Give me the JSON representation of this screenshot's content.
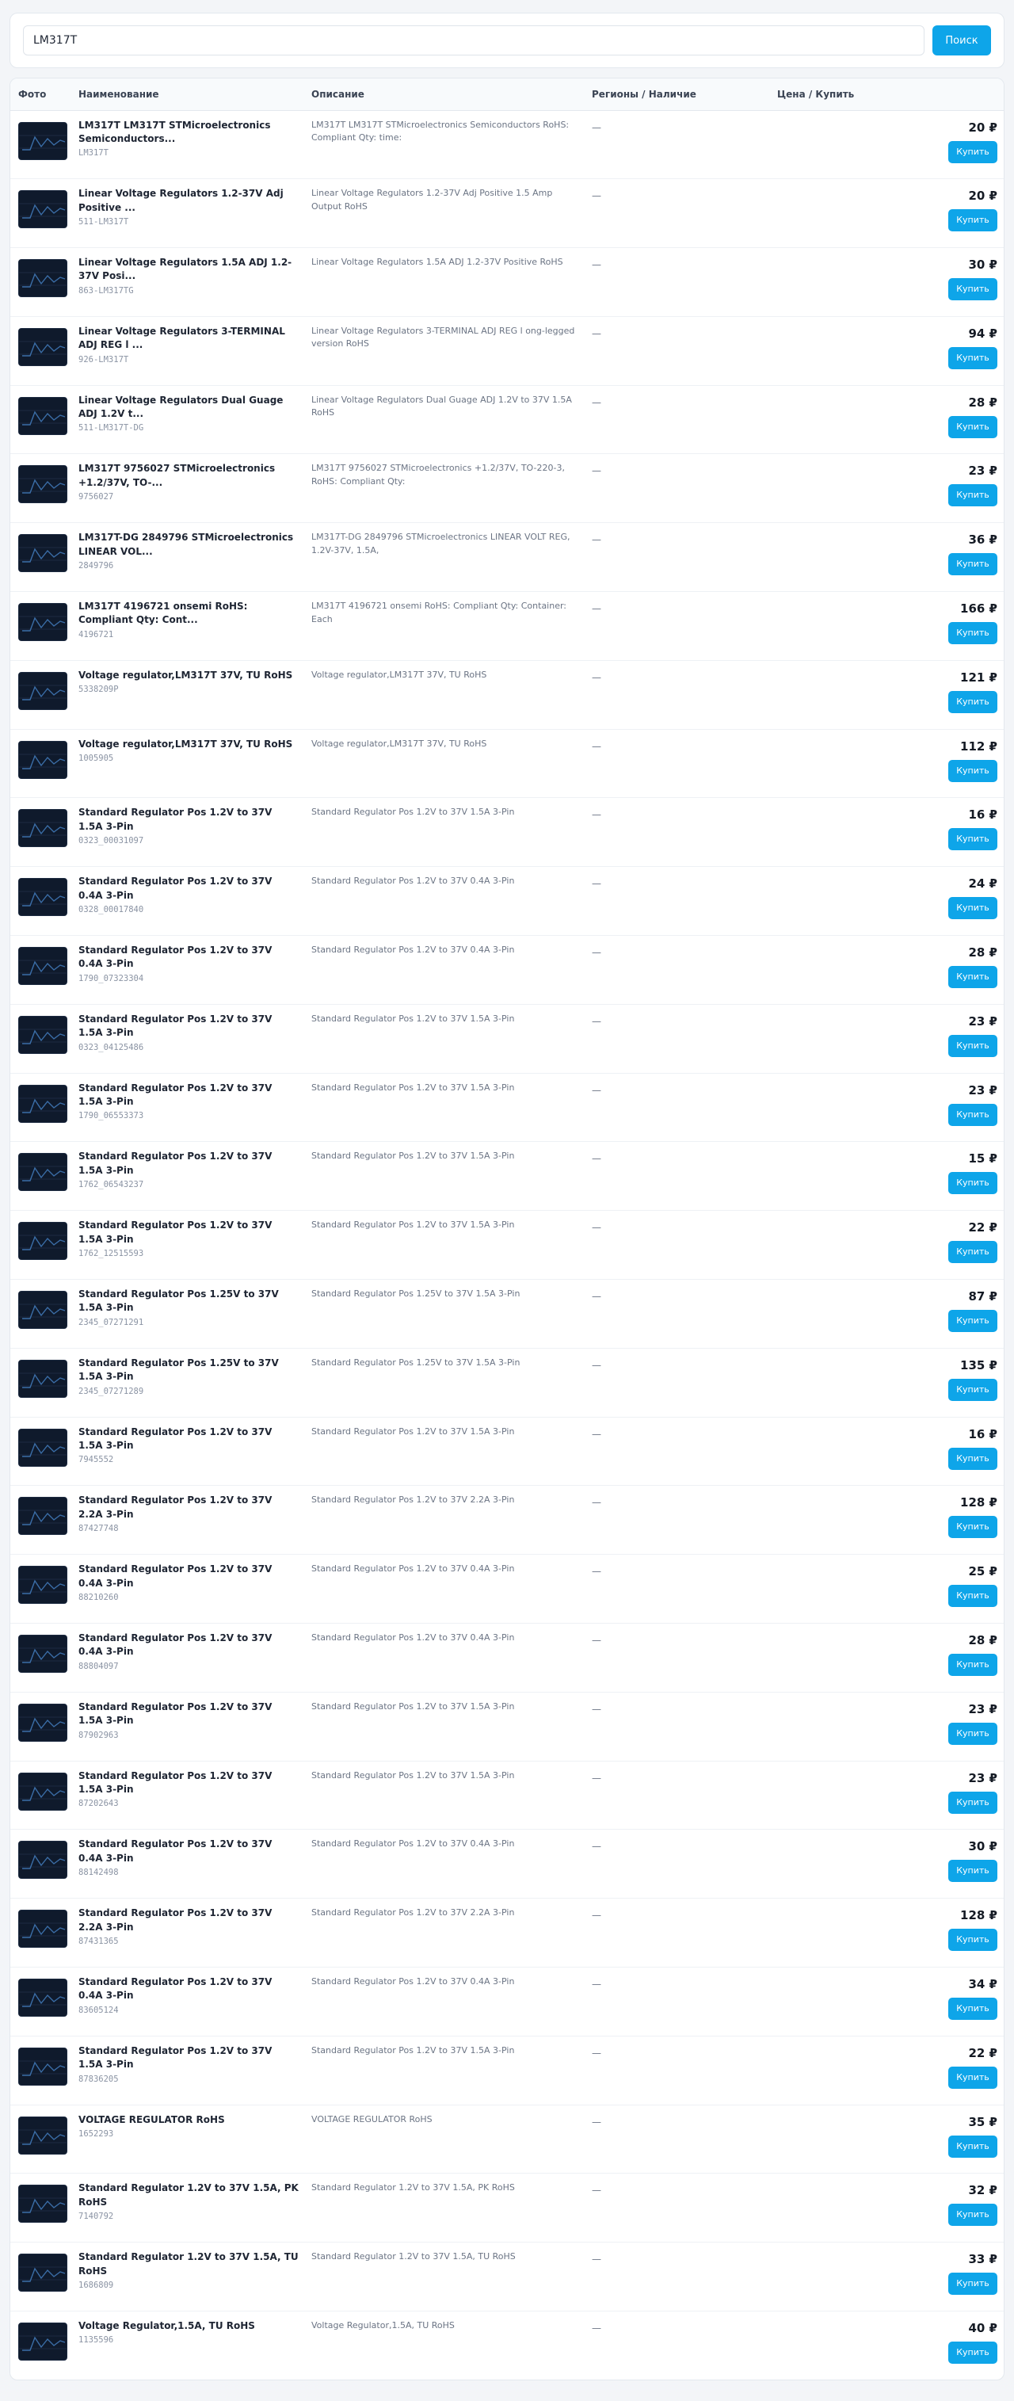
{
  "search": {
    "value": "LM317T",
    "button_label": "Поиск"
  },
  "table": {
    "headers": {
      "photo": "Фото",
      "name": "Наименование",
      "description": "Описание",
      "regions": "Регионы / Наличие",
      "price": "Цена / Купить"
    },
    "buy_label": "Купить",
    "rows": [
      {
        "name": "LM317T LM317T STMicroelectronics Semiconductors...",
        "code": "LM317T",
        "description": "LM317T LM317T STMicroelectronics Semiconductors RoHS: Compliant Qty: time:",
        "regions": "—",
        "price": "20 ₽"
      },
      {
        "name": "Linear Voltage Regulators 1.2-37V Adj Positive ...",
        "code": "511-LM317T",
        "description": "Linear Voltage Regulators 1.2-37V Adj Positive 1.5 Amp Output RoHS",
        "regions": "—",
        "price": "20 ₽"
      },
      {
        "name": "Linear Voltage Regulators 1.5A ADJ 1.2-37V Posi...",
        "code": "863-LM317TG",
        "description": "Linear Voltage Regulators 1.5A ADJ 1.2-37V Positive RoHS",
        "regions": "—",
        "price": "30 ₽"
      },
      {
        "name": "Linear Voltage Regulators 3-TERMINAL ADJ REG l ...",
        "code": "926-LM317T",
        "description": "Linear Voltage Regulators 3-TERMINAL ADJ REG l ong-legged version RoHS",
        "regions": "—",
        "price": "94 ₽"
      },
      {
        "name": "Linear Voltage Regulators Dual Guage ADJ 1.2V t...",
        "code": "511-LM317T-DG",
        "description": "Linear Voltage Regulators Dual Guage ADJ 1.2V to 37V 1.5A RoHS",
        "regions": "—",
        "price": "28 ₽"
      },
      {
        "name": "LM317T 9756027 STMicroelectronics +1.2/37V, TO-...",
        "code": "9756027",
        "description": "LM317T 9756027 STMicroelectronics +1.2/37V, TO-220-3, RoHS: Compliant Qty:",
        "regions": "—",
        "price": "23 ₽"
      },
      {
        "name": "LM317T-DG 2849796 STMicroelectronics LINEAR VOL...",
        "code": "2849796",
        "description": "LM317T-DG 2849796 STMicroelectronics LINEAR VOLT REG, 1.2V-37V, 1.5A,",
        "regions": "—",
        "price": "36 ₽"
      },
      {
        "name": "LM317T 4196721 onsemi RoHS: Compliant Qty: Cont...",
        "code": "4196721",
        "description": "LM317T 4196721 onsemi RoHS: Compliant Qty: Container: Each",
        "regions": "—",
        "price": "166 ₽"
      },
      {
        "name": "Voltage regulator,LM317T 37V, TU RoHS",
        "code": "5338209P",
        "description": "Voltage regulator,LM317T 37V, TU RoHS",
        "regions": "—",
        "price": "121 ₽"
      },
      {
        "name": "Voltage regulator,LM317T 37V, TU RoHS",
        "code": "1005905",
        "description": "Voltage regulator,LM317T 37V, TU RoHS",
        "regions": "—",
        "price": "112 ₽"
      },
      {
        "name": "Standard Regulator Pos 1.2V to 37V 1.5A 3-Pin",
        "code": "0323_00031097",
        "description": "Standard Regulator Pos 1.2V to 37V 1.5A 3-Pin",
        "regions": "—",
        "price": "16 ₽"
      },
      {
        "name": "Standard Regulator Pos 1.2V to 37V 0.4A 3-Pin",
        "code": "0328_00017840",
        "description": "Standard Regulator Pos 1.2V to 37V 0.4A 3-Pin",
        "regions": "—",
        "price": "24 ₽"
      },
      {
        "name": "Standard Regulator Pos 1.2V to 37V 0.4A 3-Pin",
        "code": "1790_07323304",
        "description": "Standard Regulator Pos 1.2V to 37V 0.4A 3-Pin",
        "regions": "—",
        "price": "28 ₽"
      },
      {
        "name": "Standard Regulator Pos 1.2V to 37V 1.5A 3-Pin",
        "code": "0323_04125486",
        "description": "Standard Regulator Pos 1.2V to 37V 1.5A 3-Pin",
        "regions": "—",
        "price": "23 ₽"
      },
      {
        "name": "Standard Regulator Pos 1.2V to 37V 1.5A 3-Pin",
        "code": "1790_06553373",
        "description": "Standard Regulator Pos 1.2V to 37V 1.5A 3-Pin",
        "regions": "—",
        "price": "23 ₽"
      },
      {
        "name": "Standard Regulator Pos 1.2V to 37V 1.5A 3-Pin",
        "code": "1762_06543237",
        "description": "Standard Regulator Pos 1.2V to 37V 1.5A 3-Pin",
        "regions": "—",
        "price": "15 ₽"
      },
      {
        "name": "Standard Regulator Pos 1.2V to 37V 1.5A 3-Pin",
        "code": "1762_12515593",
        "description": "Standard Regulator Pos 1.2V to 37V 1.5A 3-Pin",
        "regions": "—",
        "price": "22 ₽"
      },
      {
        "name": "Standard Regulator Pos 1.25V to 37V 1.5A 3-Pin",
        "code": "2345_07271291",
        "description": "Standard Regulator Pos 1.25V to 37V 1.5A 3-Pin",
        "regions": "—",
        "price": "87 ₽"
      },
      {
        "name": "Standard Regulator Pos 1.25V to 37V 1.5A 3-Pin",
        "code": "2345_07271289",
        "description": "Standard Regulator Pos 1.25V to 37V 1.5A 3-Pin",
        "regions": "—",
        "price": "135 ₽"
      },
      {
        "name": "Standard Regulator Pos 1.2V to 37V 1.5A 3-Pin",
        "code": "7945552",
        "description": "Standard Regulator Pos 1.2V to 37V 1.5A 3-Pin",
        "regions": "—",
        "price": "16 ₽"
      },
      {
        "name": "Standard Regulator Pos 1.2V to 37V 2.2A 3-Pin",
        "code": "87427748",
        "description": "Standard Regulator Pos 1.2V to 37V 2.2A 3-Pin",
        "regions": "—",
        "price": "128 ₽"
      },
      {
        "name": "Standard Regulator Pos 1.2V to 37V 0.4A 3-Pin",
        "code": "88210260",
        "description": "Standard Regulator Pos 1.2V to 37V 0.4A 3-Pin",
        "regions": "—",
        "price": "25 ₽"
      },
      {
        "name": "Standard Regulator Pos 1.2V to 37V 0.4A 3-Pin",
        "code": "88804097",
        "description": "Standard Regulator Pos 1.2V to 37V 0.4A 3-Pin",
        "regions": "—",
        "price": "28 ₽"
      },
      {
        "name": "Standard Regulator Pos 1.2V to 37V 1.5A 3-Pin",
        "code": "87902963",
        "description": "Standard Regulator Pos 1.2V to 37V 1.5A 3-Pin",
        "regions": "—",
        "price": "23 ₽"
      },
      {
        "name": "Standard Regulator Pos 1.2V to 37V 1.5A 3-Pin",
        "code": "87202643",
        "description": "Standard Regulator Pos 1.2V to 37V 1.5A 3-Pin",
        "regions": "—",
        "price": "23 ₽"
      },
      {
        "name": "Standard Regulator Pos 1.2V to 37V 0.4A 3-Pin",
        "code": "88142498",
        "description": "Standard Regulator Pos 1.2V to 37V 0.4A 3-Pin",
        "regions": "—",
        "price": "30 ₽"
      },
      {
        "name": "Standard Regulator Pos 1.2V to 37V 2.2A 3-Pin",
        "code": "87431365",
        "description": "Standard Regulator Pos 1.2V to 37V 2.2A 3-Pin",
        "regions": "—",
        "price": "128 ₽"
      },
      {
        "name": "Standard Regulator Pos 1.2V to 37V 0.4A 3-Pin",
        "code": "83605124",
        "description": "Standard Regulator Pos 1.2V to 37V 0.4A 3-Pin",
        "regions": "—",
        "price": "34 ₽"
      },
      {
        "name": "Standard Regulator Pos 1.2V to 37V 1.5A 3-Pin",
        "code": "87836205",
        "description": "Standard Regulator Pos 1.2V to 37V 1.5A 3-Pin",
        "regions": "—",
        "price": "22 ₽"
      },
      {
        "name": "VOLTAGE REGULATOR RoHS",
        "code": "1652293",
        "description": "VOLTAGE REGULATOR RoHS",
        "regions": "—",
        "price": "35 ₽"
      },
      {
        "name": "Standard Regulator 1.2V to 37V 1.5A, PK RoHS",
        "code": "7140792",
        "description": "Standard Regulator 1.2V to 37V 1.5A, PK RoHS",
        "regions": "—",
        "price": "32 ₽"
      },
      {
        "name": "Standard Regulator 1.2V to 37V 1.5A, TU RoHS",
        "code": "1686809",
        "description": "Standard Regulator 1.2V to 37V 1.5A, TU RoHS",
        "regions": "—",
        "price": "33 ₽"
      },
      {
        "name": "Voltage Regulator,1.5A, TU RoHS",
        "code": "1135596",
        "description": "Voltage Regulator,1.5A, TU RoHS",
        "regions": "—",
        "price": "40 ₽"
      }
    ]
  }
}
